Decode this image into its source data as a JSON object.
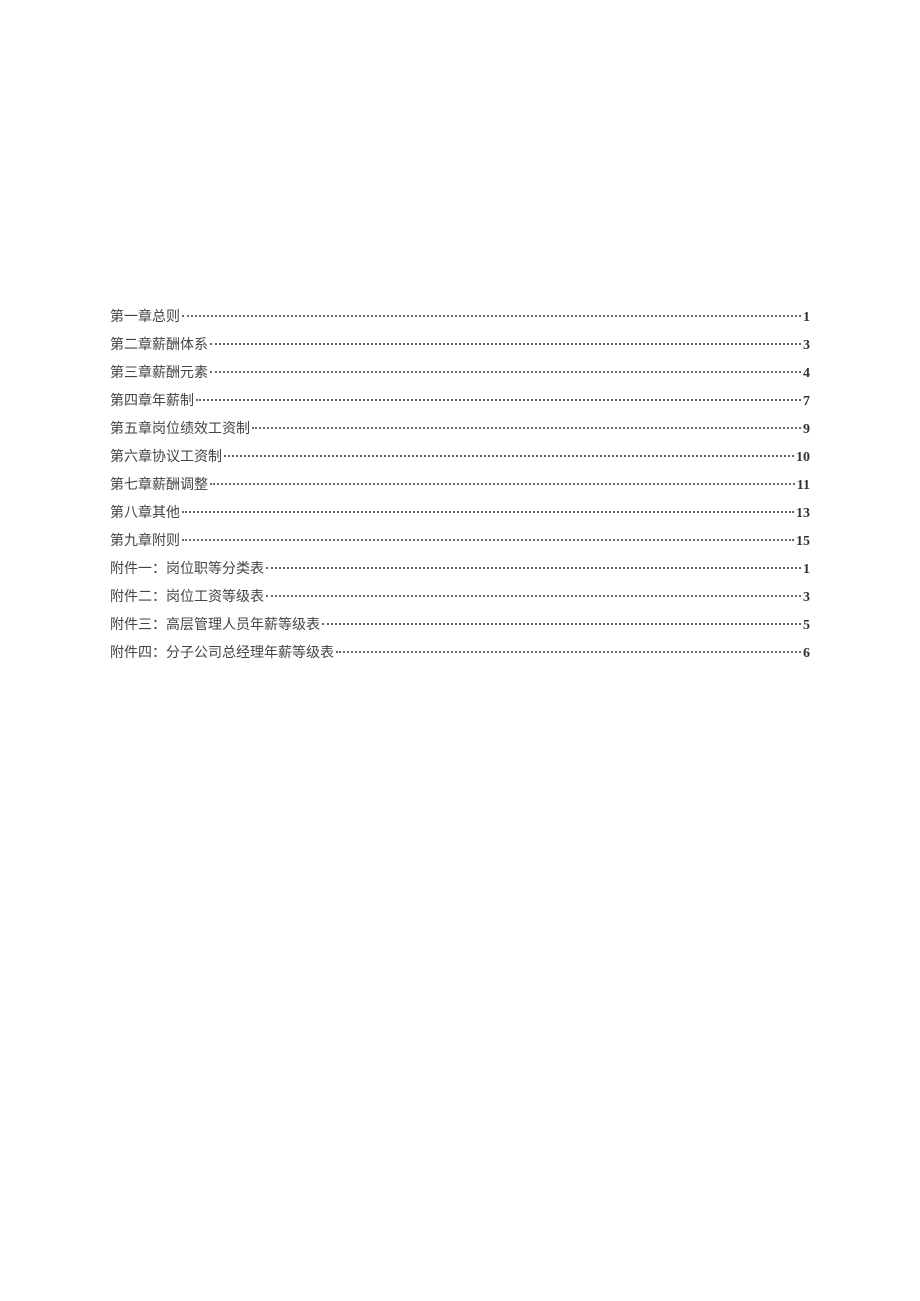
{
  "toc": {
    "entries": [
      {
        "title": "第一章总则",
        "page": "1"
      },
      {
        "title": "第二章薪酬体系",
        "page": "3"
      },
      {
        "title": "第三章薪酬元素",
        "page": "4"
      },
      {
        "title": "第四章年薪制",
        "page": "7"
      },
      {
        "title": "第五章岗位绩效工资制",
        "page": "9"
      },
      {
        "title": "第六章协议工资制",
        "page": "10"
      },
      {
        "title": "第七章薪酬调整",
        "page": "11"
      },
      {
        "title": "第八章其他",
        "page": "13"
      },
      {
        "title": "第九章附则",
        "page": "15"
      },
      {
        "title": "附件一：岗位职等分类表",
        "page": "1"
      },
      {
        "title": "附件二：岗位工资等级表",
        "page": "3"
      },
      {
        "title": "附件三：高层管理人员年薪等级表",
        "page": "5"
      },
      {
        "title": "附件四：分子公司总经理年薪等级表",
        "page": "6"
      }
    ]
  }
}
